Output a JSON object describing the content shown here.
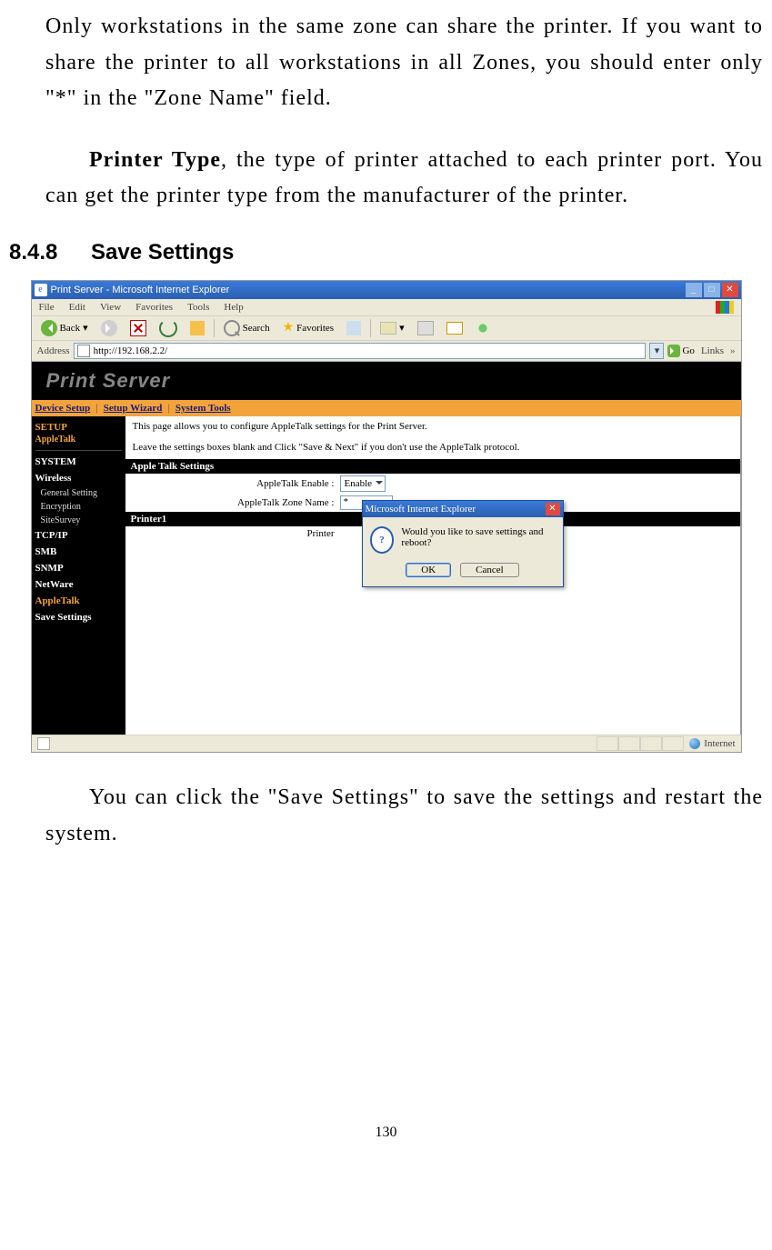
{
  "doc": {
    "para1": "Only workstations in the same zone can share the printer. If you want to share the printer to all workstations in all Zones, you should enter only \"*\" in the \"Zone Name\" field.",
    "para2_bold": "Printer Type",
    "para2_rest": ", the type of printer attached to each printer port. You can get the printer type from the manufacturer of the printer.",
    "section_num": "8.4.8",
    "section_title": "Save Settings",
    "para3": "You can click the \"Save Settings\" to save the settings and restart the system.",
    "page_number": "130"
  },
  "browser": {
    "title": "Print Server - Microsoft Internet Explorer",
    "menu": {
      "file": "File",
      "edit": "Edit",
      "view": "View",
      "favorites": "Favorites",
      "tools": "Tools",
      "help": "Help"
    },
    "toolbar": {
      "back": "Back",
      "search": "Search",
      "favorites": "Favorites"
    },
    "address_label": "Address",
    "address_value": "http://192.168.2.2/",
    "go": "Go",
    "links": "Links",
    "status_left": "",
    "status_right": "Internet"
  },
  "printserver": {
    "logo": "Print Server",
    "tabs": {
      "device": "Device Setup",
      "wizard": "Setup Wizard",
      "tools": "System Tools",
      "sep": "|"
    },
    "side": {
      "setup": "SETUP",
      "sub": "AppleTalk",
      "system": "SYSTEM",
      "wireless": "Wireless",
      "w1": "General Setting",
      "w2": "Encryption",
      "w3": "SiteSurvey",
      "tcpip": "TCP/IP",
      "smb": "SMB",
      "snmp": "SNMP",
      "netware": "NetWare",
      "appletalk": "AppleTalk",
      "save": "Save Settings"
    },
    "intro1": "This page allows you to configure AppleTalk settings for the Print Server.",
    "intro2": "Leave the settings boxes blank and Click \"Save & Next\" if you don't use the AppleTalk protocol.",
    "section1": "Apple Talk Settings",
    "field_enable": "AppleTalk Enable :",
    "enable_value": "Enable",
    "field_zone": "AppleTalk Zone Name :",
    "zone_value": "*",
    "section2": "Printer1",
    "field_printer": "Printer"
  },
  "dialog": {
    "title": "Microsoft Internet Explorer",
    "message": "Would you like to save settings and reboot?",
    "ok": "OK",
    "cancel": "Cancel"
  }
}
